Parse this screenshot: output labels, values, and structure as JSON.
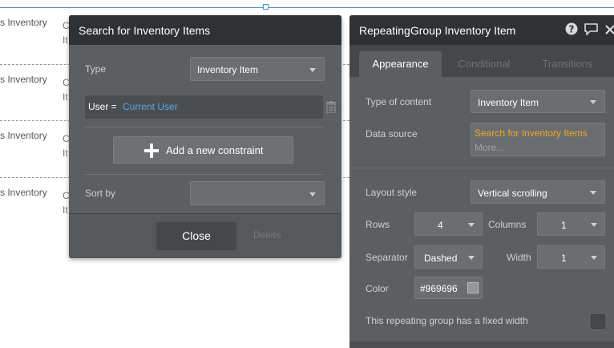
{
  "canvas": {
    "cells": [
      {
        "name": "s Inventory",
        "frag1": "C",
        "frag2": "It"
      },
      {
        "name": "s Inventory",
        "frag1": "C",
        "frag2": "It"
      },
      {
        "name": "s Inventory",
        "frag1": "C",
        "frag2": "It"
      },
      {
        "name": "s Inventory",
        "frag1": "C",
        "frag2": "It"
      }
    ]
  },
  "search_dialog": {
    "title": "Search for Inventory Items",
    "type_label": "Type",
    "type_value": "Inventory Item",
    "constraint_lhs": "User =",
    "constraint_rhs": "Current User",
    "add_constraint_label": "Add a new constraint",
    "sort_by_label": "Sort by",
    "sort_by_value": "",
    "close_label": "Close",
    "delete_label": "Delete"
  },
  "property_editor": {
    "title": "RepeatingGroup Inventory Item",
    "tabs": [
      {
        "label": "Appearance",
        "active": true
      },
      {
        "label": "Conditional",
        "active": false
      },
      {
        "label": "Transitions",
        "active": false
      }
    ],
    "type_of_content_label": "Type of content",
    "type_of_content_value": "Inventory Item",
    "data_source_label": "Data source",
    "data_source_value": "Search for Inventory Items",
    "data_source_more": "More...",
    "layout_style_label": "Layout style",
    "layout_style_value": "Vertical scrolling",
    "rows_label": "Rows",
    "rows_value": "4",
    "columns_label": "Columns",
    "columns_value": "1",
    "separator_label": "Separator",
    "separator_value": "Dashed",
    "width_label": "Width",
    "width_value": "1",
    "color_label": "Color",
    "color_value": "#969696",
    "fixed_width_label": "This repeating group has a fixed width",
    "fixed_width_checked": false
  },
  "colors": {
    "panel_bg": "#5b5f62",
    "header_bg": "#2f3235",
    "link_blue": "#5ba3e8",
    "dynamic_orange": "#f5a623",
    "selection_blue": "#4a90c8",
    "separator_color": "#969696"
  },
  "icons": {
    "help": "question-circle-icon",
    "comment": "speech-bubble-icon",
    "close": "x-icon",
    "trash": "trash-icon",
    "plus": "plus-icon",
    "caret": "caret-down-icon"
  }
}
